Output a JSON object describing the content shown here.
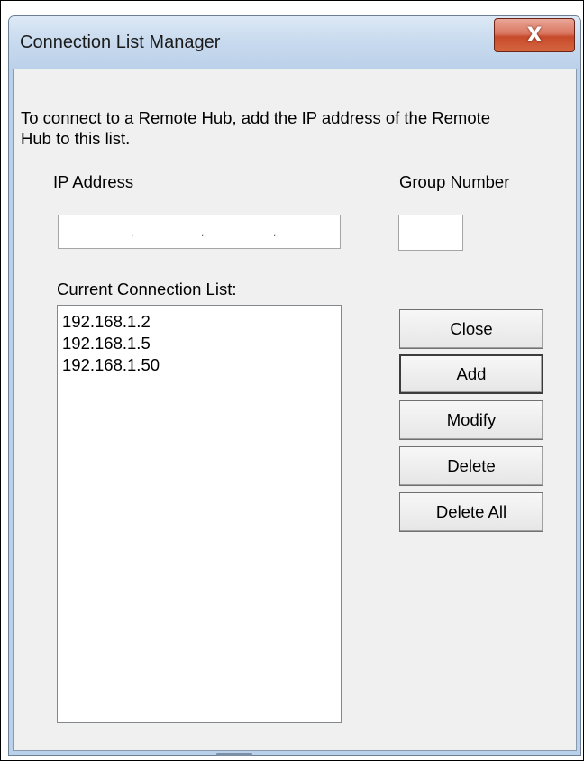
{
  "window": {
    "title": "Connection List Manager",
    "close_glyph": "X"
  },
  "info": {
    "text": "To connect to a Remote Hub, add the IP address of the Remote Hub to this list."
  },
  "ip_address": {
    "label": "IP Address",
    "value": "",
    "separators": [
      ".",
      ".",
      "."
    ]
  },
  "group_number": {
    "label": "Group Number",
    "value": ""
  },
  "connection_list": {
    "label": "Current Connection List:",
    "items": [
      "192.168.1.2",
      "192.168.1.5",
      "192.168.1.50"
    ]
  },
  "buttons": {
    "close": "Close",
    "add": "Add",
    "modify": "Modify",
    "delete": "Delete",
    "delete_all": "Delete All"
  },
  "colors": {
    "title_bar": "#c8daee",
    "client_bg": "#f0f0f0",
    "close_button": "#c74a2b"
  }
}
